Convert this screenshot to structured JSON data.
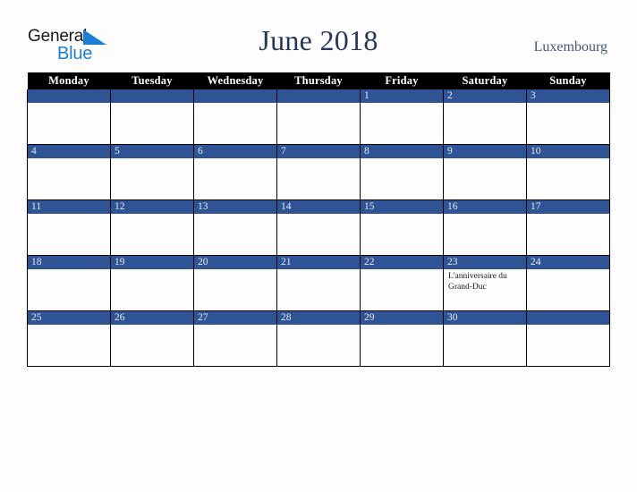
{
  "brand": {
    "name_top": "General",
    "name_bottom": "Blue",
    "triangle_icon": "blue-triangle-icon",
    "color_dark": "#1a1a1a",
    "color_blue": "#1b7fd4"
  },
  "header": {
    "title": "June 2018",
    "country": "Luxembourg",
    "title_color": "#26385c",
    "country_color": "#46557a"
  },
  "calendar": {
    "header_bg": "#000000",
    "header_fg": "#ffffff",
    "daybar_bg": "#2e5496",
    "daybar_fg": "#e8eaf0",
    "cell_bg": "#fdfdfd",
    "grid_color": "#000000",
    "weekday_headers": [
      "Monday",
      "Tuesday",
      "Wednesday",
      "Thursday",
      "Friday",
      "Saturday",
      "Sunday"
    ],
    "weeks": [
      [
        {
          "date": "",
          "event": ""
        },
        {
          "date": "",
          "event": ""
        },
        {
          "date": "",
          "event": ""
        },
        {
          "date": "",
          "event": ""
        },
        {
          "date": "1",
          "event": ""
        },
        {
          "date": "2",
          "event": ""
        },
        {
          "date": "3",
          "event": ""
        }
      ],
      [
        {
          "date": "4",
          "event": ""
        },
        {
          "date": "5",
          "event": ""
        },
        {
          "date": "6",
          "event": ""
        },
        {
          "date": "7",
          "event": ""
        },
        {
          "date": "8",
          "event": ""
        },
        {
          "date": "9",
          "event": ""
        },
        {
          "date": "10",
          "event": ""
        }
      ],
      [
        {
          "date": "11",
          "event": ""
        },
        {
          "date": "12",
          "event": ""
        },
        {
          "date": "13",
          "event": ""
        },
        {
          "date": "14",
          "event": ""
        },
        {
          "date": "15",
          "event": ""
        },
        {
          "date": "16",
          "event": ""
        },
        {
          "date": "17",
          "event": ""
        }
      ],
      [
        {
          "date": "18",
          "event": ""
        },
        {
          "date": "19",
          "event": ""
        },
        {
          "date": "20",
          "event": ""
        },
        {
          "date": "21",
          "event": ""
        },
        {
          "date": "22",
          "event": ""
        },
        {
          "date": "23",
          "event": "L'anniversaire du Grand-Duc"
        },
        {
          "date": "24",
          "event": ""
        }
      ],
      [
        {
          "date": "25",
          "event": ""
        },
        {
          "date": "26",
          "event": ""
        },
        {
          "date": "27",
          "event": ""
        },
        {
          "date": "28",
          "event": ""
        },
        {
          "date": "29",
          "event": ""
        },
        {
          "date": "30",
          "event": ""
        },
        {
          "date": "",
          "event": ""
        }
      ]
    ]
  }
}
